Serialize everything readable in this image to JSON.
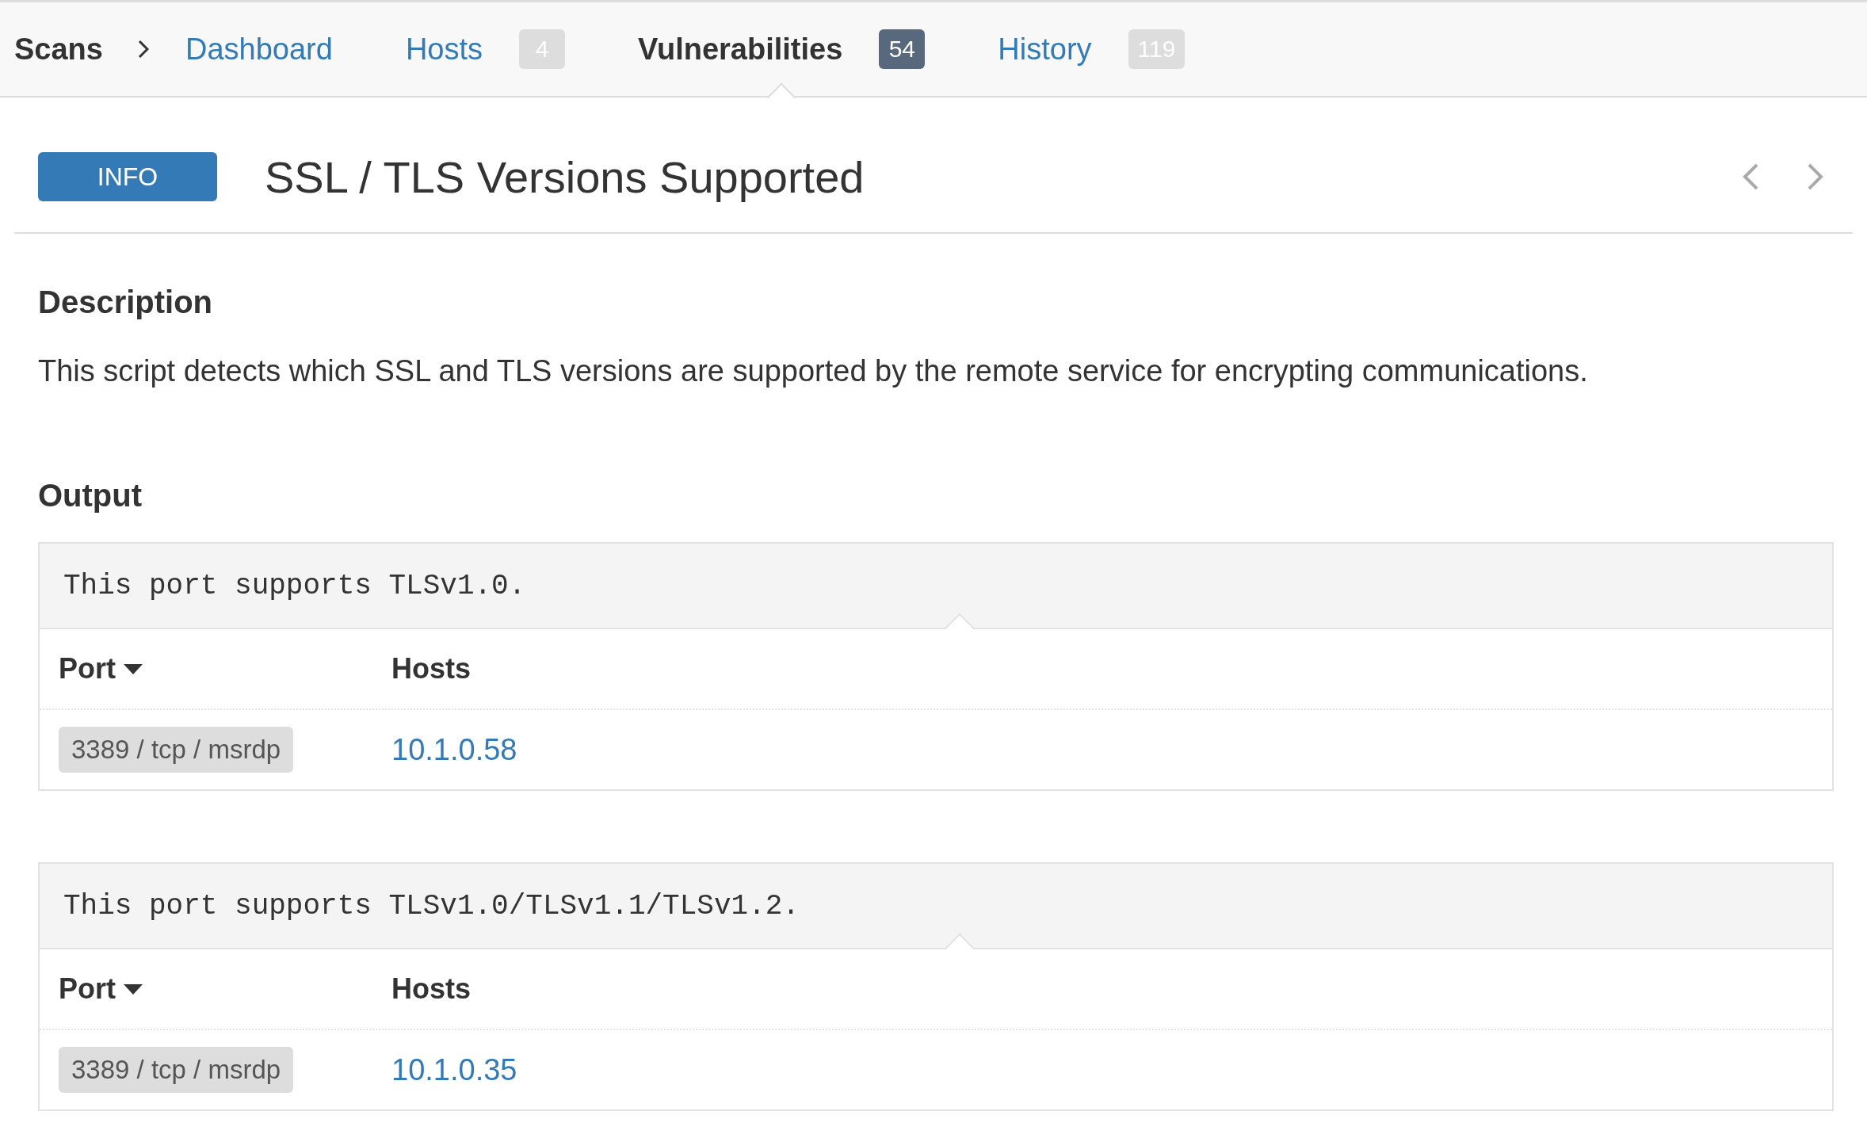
{
  "nav": {
    "root": "Scans",
    "tabs": [
      {
        "label": "Dashboard",
        "selected": false
      },
      {
        "label": "Hosts",
        "count": "4",
        "selected": false
      },
      {
        "label": "Vulnerabilities",
        "count": "54",
        "selected": true
      },
      {
        "label": "History",
        "count": "119",
        "selected": false
      }
    ]
  },
  "finding": {
    "severity": "INFO",
    "title": "SSL / TLS Versions Supported"
  },
  "description": {
    "heading": "Description",
    "text": "This script detects which SSL and TLS versions are supported by the remote service for encrypting communications."
  },
  "output": {
    "heading": "Output",
    "blocks": [
      {
        "text": "This port supports TLSv1.0.",
        "columns": [
          "Port",
          "Hosts"
        ],
        "rows": [
          {
            "port": "3389 / tcp / msrdp",
            "host": "10.1.0.58"
          }
        ]
      },
      {
        "text": "This port supports TLSv1.0/TLSv1.1/TLSv1.2.",
        "columns": [
          "Port",
          "Hosts"
        ],
        "rows": [
          {
            "port": "3389 / tcp / msrdp",
            "host": "10.1.0.35"
          }
        ]
      }
    ]
  }
}
